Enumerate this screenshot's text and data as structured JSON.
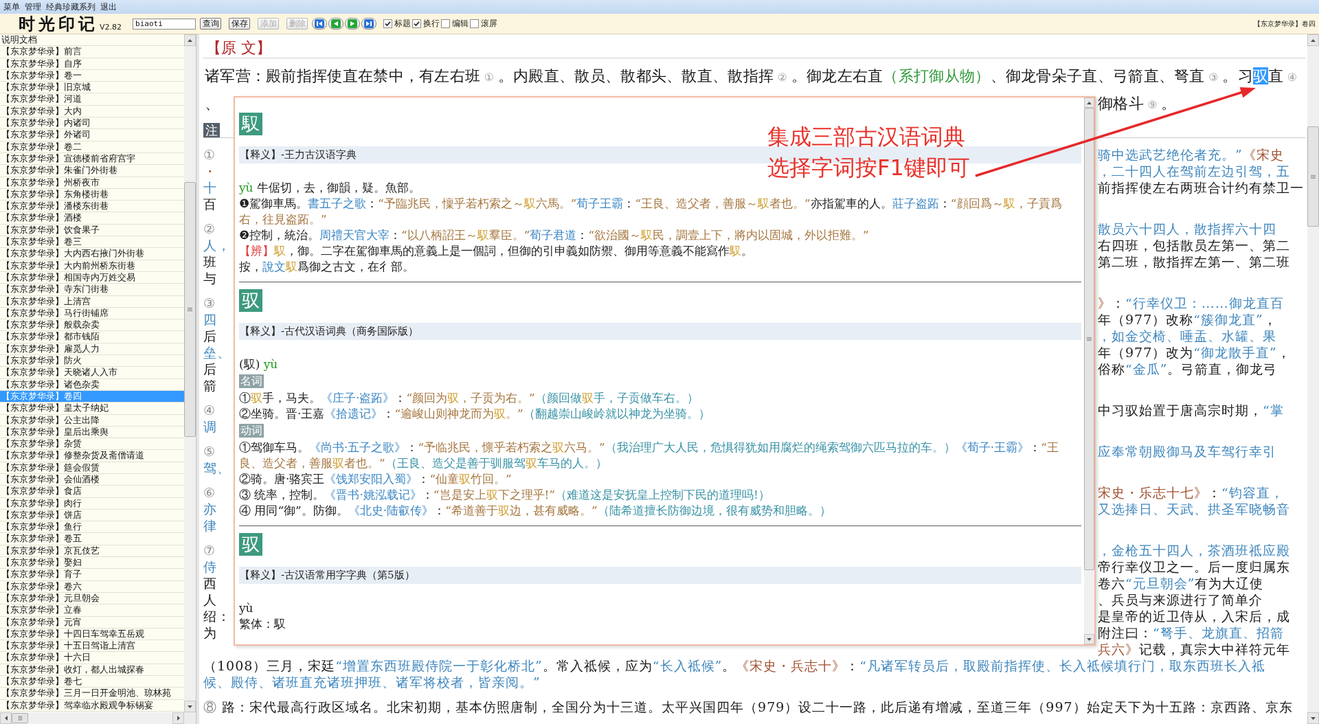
{
  "menu": [
    "菜单",
    "管理",
    "经典珍藏系列",
    "退出"
  ],
  "toolbar": {
    "logo": "时光印记",
    "version": "V2.82",
    "search": {
      "value": "biaoti"
    },
    "buttons": [
      {
        "label": "查询",
        "disabled": false
      },
      {
        "label": "保存",
        "disabled": false
      },
      {
        "label": "添加",
        "disabled": true
      },
      {
        "label": "删除",
        "disabled": true
      }
    ],
    "nav_buttons": [
      {
        "kind": "first"
      },
      {
        "kind": "previous"
      },
      {
        "kind": "next"
      },
      {
        "kind": "last"
      }
    ],
    "checkboxes": [
      {
        "label": "标题",
        "checked": true
      },
      {
        "label": "换行",
        "checked": true
      },
      {
        "label": "编辑",
        "checked": false
      },
      {
        "label": "滚屏",
        "checked": false
      }
    ],
    "location": "【东京梦华录】卷四"
  },
  "sidebar": {
    "items": [
      {
        "label": "说明文档",
        "selected": false
      },
      {
        "label": "【东京梦华录】前言",
        "selected": false
      },
      {
        "label": "【东京梦华录】自序",
        "selected": false
      },
      {
        "label": "【东京梦华录】卷一",
        "selected": false
      },
      {
        "label": "【东京梦华录】旧京城",
        "selected": false
      },
      {
        "label": "【东京梦华录】河道",
        "selected": false
      },
      {
        "label": "【东京梦华录】大内",
        "selected": false
      },
      {
        "label": "【东京梦华录】内诸司",
        "selected": false
      },
      {
        "label": "【东京梦华录】外诸司",
        "selected": false
      },
      {
        "label": "【东京梦华录】卷二",
        "selected": false
      },
      {
        "label": "【东京梦华录】宣德楼前省府宫宇",
        "selected": false
      },
      {
        "label": "【东京梦华录】朱雀门外街巷",
        "selected": false
      },
      {
        "label": "【东京梦华录】州桥夜市",
        "selected": false
      },
      {
        "label": "【东京梦华录】东角楼街巷",
        "selected": false
      },
      {
        "label": "【东京梦华录】潘楼东街巷",
        "selected": false
      },
      {
        "label": "【东京梦华录】酒楼",
        "selected": false
      },
      {
        "label": "【东京梦华录】饮食果子",
        "selected": false
      },
      {
        "label": "【东京梦华录】卷三",
        "selected": false
      },
      {
        "label": "【东京梦华录】大内西右掖门外街巷",
        "selected": false
      },
      {
        "label": "【东京梦华录】大内前州桥东街巷",
        "selected": false
      },
      {
        "label": "【东京梦华录】相国寺内万姓交易",
        "selected": false
      },
      {
        "label": "【东京梦华录】寺东门街巷",
        "selected": false
      },
      {
        "label": "【东京梦华录】上清宫",
        "selected": false
      },
      {
        "label": "【东京梦华录】马行街铺席",
        "selected": false
      },
      {
        "label": "【东京梦华录】般载杂卖",
        "selected": false
      },
      {
        "label": "【东京梦华录】都市钱陌",
        "selected": false
      },
      {
        "label": "【东京梦华录】雇觅人力",
        "selected": false
      },
      {
        "label": "【东京梦华录】防火",
        "selected": false
      },
      {
        "label": "【东京梦华录】天晓诸人入市",
        "selected": false
      },
      {
        "label": "【东京梦华录】诸色杂卖",
        "selected": false
      },
      {
        "label": "【东京梦华录】卷四",
        "selected": true
      },
      {
        "label": "【东京梦华录】皇太子纳妃",
        "selected": false
      },
      {
        "label": "【东京梦华录】公主出降",
        "selected": false
      },
      {
        "label": "【东京梦华录】皇后出乘舆",
        "selected": false
      },
      {
        "label": "【东京梦华录】杂赁",
        "selected": false
      },
      {
        "label": "【东京梦华录】修整杂货及斋僧请道",
        "selected": false
      },
      {
        "label": "【东京梦华录】筵会假赁",
        "selected": false
      },
      {
        "label": "【东京梦华录】会仙酒楼",
        "selected": false
      },
      {
        "label": "【东京梦华录】食店",
        "selected": false
      },
      {
        "label": "【东京梦华录】肉行",
        "selected": false
      },
      {
        "label": "【东京梦华录】饼店",
        "selected": false
      },
      {
        "label": "【东京梦华录】鱼行",
        "selected": false
      },
      {
        "label": "【东京梦华录】卷五",
        "selected": false
      },
      {
        "label": "【东京梦华录】京瓦伎艺",
        "selected": false
      },
      {
        "label": "【东京梦华录】娶妇",
        "selected": false
      },
      {
        "label": "【东京梦华录】育子",
        "selected": false
      },
      {
        "label": "【东京梦华录】卷六",
        "selected": false
      },
      {
        "label": "【东京梦华录】元旦朝会",
        "selected": false
      },
      {
        "label": "【东京梦华录】立春",
        "selected": false
      },
      {
        "label": "【东京梦华录】元宵",
        "selected": false
      },
      {
        "label": "【东京梦华录】十四日车驾幸五岳观",
        "selected": false
      },
      {
        "label": "【东京梦华录】十五日驾诣上清宫",
        "selected": false
      },
      {
        "label": "【东京梦华录】十六日",
        "selected": false
      },
      {
        "label": "【东京梦华录】收灯，都人出城探春",
        "selected": false
      },
      {
        "label": "【东京梦华录】卷七",
        "selected": false
      },
      {
        "label": "【东京梦华录】三月一日开金明池、琼林苑",
        "selected": false
      },
      {
        "label": "【东京梦华录】驾幸临水殿观争标锡宴",
        "selected": false
      }
    ]
  },
  "document": {
    "heading": "【原 文】",
    "lines": [
      {
        "kind": "full",
        "runs": [
          {
            "kind": "plain",
            "text": "诸军营：殿前指挥使直在禁中，有左右班"
          },
          {
            "kind": "num",
            "text": " ① "
          },
          {
            "kind": "plain",
            "text": "。内殿直、散员、散都头、散直、散指挥"
          },
          {
            "kind": "num",
            "text": " ② "
          },
          {
            "kind": "plain",
            "text": "。御龙左右直"
          },
          {
            "kind": "aside",
            "text": "（系打御从物）"
          },
          {
            "kind": "plain",
            "text": "、御龙骨朵子直、弓箭直、弩直"
          },
          {
            "kind": "num",
            "text": " ③ "
          },
          {
            "kind": "plain",
            "text": "。习"
          },
          {
            "kind": "selected",
            "text": "驭"
          },
          {
            "kind": "plain",
            "text": "直"
          },
          {
            "kind": "num",
            "text": " ④"
          }
        ]
      },
      {
        "kind": "split",
        "left": [
          {
            "kind": "plain",
            "text": "、"
          }
        ],
        "right": [
          {
            "kind": "plain",
            "text": "御格斗"
          },
          {
            "kind": "num",
            "text": " ⑨ "
          },
          {
            "kind": "plain",
            "text": "。"
          }
        ]
      }
    ],
    "notes_label": "注",
    "notes": [
      {
        "lines": [
          {
            "kind": "split",
            "left": [
              {
                "kind": "num",
                "text": "①"
              }
            ],
            "right": [
              {
                "kind": "quoted",
                "text": "骑中选武艺绝伦者充。”"
              },
              {
                "kind": "title",
                "text": "《宋史"
              }
            ]
          },
          {
            "kind": "split",
            "left": [
              {
                "kind": "title",
                "text": "・"
              }
            ],
            "right": [
              {
                "kind": "quoted",
                "text": "，二十四人在驾前左边引驾，五"
              }
            ]
          },
          {
            "kind": "split",
            "left": [
              {
                "kind": "quoted",
                "text": "十"
              }
            ],
            "right": [
              {
                "kind": "plain",
                "text": "前指挥使左右两班合计约有禁卫一"
              }
            ]
          },
          {
            "kind": "split",
            "left": [
              {
                "kind": "plain",
                "text": "百"
              }
            ]
          }
        ]
      },
      {
        "lines": [
          {
            "kind": "split",
            "left": [
              {
                "kind": "num",
                "text": "②"
              }
            ],
            "right": [
              {
                "kind": "quoted",
                "text": "散员六十四人，散指挥六十四"
              }
            ]
          },
          {
            "kind": "split",
            "left": [
              {
                "kind": "quoted",
                "text": "人，"
              }
            ],
            "right": [
              {
                "kind": "plain",
                "text": "右四班，包括散员左第一、第二"
              }
            ]
          },
          {
            "kind": "split",
            "left": [
              {
                "kind": "plain",
                "text": "班"
              }
            ],
            "right": [
              {
                "kind": "plain",
                "text": "第二班，散指挥左第一、第二班"
              }
            ]
          },
          {
            "kind": "split",
            "left": [
              {
                "kind": "plain",
                "text": "与"
              }
            ]
          }
        ]
      },
      {
        "lines": [
          {
            "kind": "split",
            "left": [
              {
                "kind": "num",
                "text": "③"
              }
            ],
            "right": [
              {
                "kind": "title",
                "text": "》"
              },
              {
                "kind": "plain",
                "text": "："
              },
              {
                "kind": "quoted",
                "text": "“行幸仪卫：……御龙直百"
              }
            ]
          },
          {
            "kind": "split",
            "left": [
              {
                "kind": "quoted",
                "text": "四"
              }
            ],
            "right": [
              {
                "kind": "plain",
                "text": "年（977）改称"
              },
              {
                "kind": "quoted",
                "text": "“簇御龙直”"
              },
              {
                "kind": "plain",
                "text": "，"
              }
            ]
          },
          {
            "kind": "split",
            "left": [
              {
                "kind": "plain",
                "text": "后"
              }
            ],
            "right": [
              {
                "kind": "quoted",
                "text": "，如金交椅、唾盂、水罐、果"
              }
            ]
          },
          {
            "kind": "split",
            "left": [
              {
                "kind": "quoted",
                "text": "垒、"
              }
            ],
            "right": [
              {
                "kind": "plain",
                "text": "年（977）改为"
              },
              {
                "kind": "quoted",
                "text": "“御龙散手直”"
              },
              {
                "kind": "plain",
                "text": "，"
              }
            ]
          },
          {
            "kind": "split",
            "left": [
              {
                "kind": "plain",
                "text": "后"
              }
            ],
            "right": [
              {
                "kind": "plain",
                "text": "俗称"
              },
              {
                "kind": "quoted",
                "text": "“金瓜”"
              },
              {
                "kind": "plain",
                "text": "。弓箭直，御龙弓"
              }
            ]
          },
          {
            "kind": "split",
            "left": [
              {
                "kind": "plain",
                "text": "箭"
              }
            ]
          }
        ]
      },
      {
        "lines": [
          {
            "kind": "split",
            "left": [
              {
                "kind": "num",
                "text": "④"
              }
            ],
            "right": [
              {
                "kind": "plain",
                "text": "中习驭始置于唐高宗时期，"
              },
              {
                "kind": "quoted",
                "text": "“掌"
              }
            ]
          },
          {
            "kind": "split",
            "left": [
              {
                "kind": "quoted",
                "text": "调"
              }
            ]
          }
        ]
      },
      {
        "lines": [
          {
            "kind": "split",
            "left": [
              {
                "kind": "num",
                "text": "⑤"
              }
            ],
            "right": [
              {
                "kind": "quoted",
                "text": "应奉常朝殿御马及车驾行幸引"
              }
            ]
          },
          {
            "kind": "split",
            "left": [
              {
                "kind": "quoted",
                "text": "驾、"
              }
            ]
          }
        ]
      },
      {
        "lines": [
          {
            "kind": "split",
            "left": [
              {
                "kind": "num",
                "text": "⑥"
              }
            ],
            "right": [
              {
                "kind": "title",
                "text": "宋史・乐志十七》"
              },
              {
                "kind": "plain",
                "text": "："
              },
              {
                "kind": "quoted",
                "text": "“钧容直，"
              }
            ]
          },
          {
            "kind": "split",
            "left": [
              {
                "kind": "quoted",
                "text": "亦"
              }
            ],
            "right": [
              {
                "kind": "quoted",
                "text": "又选捧日、天武、拱圣军晓畅音"
              }
            ]
          },
          {
            "kind": "split",
            "left": [
              {
                "kind": "quoted",
                "text": "律"
              }
            ]
          }
        ]
      },
      {
        "lines": [
          {
            "kind": "split",
            "left": [
              {
                "kind": "num",
                "text": "⑦"
              }
            ],
            "right": [
              {
                "kind": "quoted",
                "text": "，金枪五十四人，茶酒班祗应殿"
              }
            ]
          },
          {
            "kind": "split",
            "left": [
              {
                "kind": "quoted",
                "text": "侍"
              }
            ],
            "right": [
              {
                "kind": "plain",
                "text": "帝行幸仪卫之一。后一度归属东"
              }
            ]
          },
          {
            "kind": "split",
            "left": [
              {
                "kind": "plain",
                "text": "西"
              }
            ],
            "right": [
              {
                "kind": "plain",
                "text": "卷六"
              },
              {
                "kind": "quoted",
                "text": "“元旦朝会”"
              },
              {
                "kind": "plain",
                "text": "有为大辽使"
              }
            ]
          },
          {
            "kind": "split",
            "left": [
              {
                "kind": "plain",
                "text": "人"
              }
            ],
            "right": [
              {
                "kind": "plain",
                "text": "、兵员与来源进行了简单介"
              }
            ]
          },
          {
            "kind": "split",
            "left": [
              {
                "kind": "plain",
                "text": "绍："
              }
            ],
            "right": [
              {
                "kind": "plain",
                "text": "是皇帝的近卫侍从，入宋后，成"
              }
            ]
          },
          {
            "kind": "split",
            "left": [
              {
                "kind": "plain",
                "text": "为"
              }
            ],
            "right": [
              {
                "kind": "plain",
                "text": "附注曰："
              },
              {
                "kind": "quoted",
                "text": "“弩手、龙旗直、招箭"
              }
            ]
          },
          {
            "kind": "split",
            "right": [
              {
                "kind": "title",
                "text": "兵六》"
              },
              {
                "kind": "plain",
                "text": "记载，真宗大中祥符元年"
              }
            ]
          },
          {
            "kind": "full",
            "runs": [
              {
                "kind": "plain",
                "text": "（1008）三月，宋廷"
              },
              {
                "kind": "quoted",
                "text": "“增置东西班殿侍院一于彰化桥北”"
              },
              {
                "kind": "plain",
                "text": "。常入祗候，应为"
              },
              {
                "kind": "quoted",
                "text": "“长入祗候”"
              },
              {
                "kind": "plain",
                "text": "。"
              },
              {
                "kind": "title",
                "text": "《宋史・兵志十》"
              },
              {
                "kind": "plain",
                "text": "："
              },
              {
                "kind": "quoted",
                "text": "“凡诸军转员后，取殿前指挥使、长入祗候填行门，取东西班长入祗"
              }
            ]
          },
          {
            "kind": "full",
            "runs": [
              {
                "kind": "quoted",
                "text": "候、殿侍、诸班直充诸班押班、诸军将校者，皆亲阅。”"
              }
            ]
          }
        ]
      },
      {
        "lines": [
          {
            "kind": "full",
            "runs": [
              {
                "kind": "num",
                "text": "⑧"
              },
              {
                "kind": "plain",
                "text": " 路：宋代最高行政区域名。北宋初期，基本仿照唐制，全国分为十三道。太平兴国四年（979）设二十一路，此后递有增减，至道三年（997）始定天下为十五路：京西路、京东"
              }
            ]
          }
        ]
      }
    ]
  },
  "popup": {
    "entries": [
      {
        "headword": "馭",
        "source": "【释义】-王力古汉语字典",
        "lines": [
          {
            "kind": "text",
            "runs": [
              {
                "kind": "pinyin",
                "text": "yù"
              },
              {
                "kind": "plain",
                "text": " 牛倨切，去，御韻，疑。魚部。"
              }
            ]
          },
          {
            "kind": "text",
            "runs": [
              {
                "kind": "plain",
                "text": "❶駕御車馬。"
              },
              {
                "kind": "book",
                "text": "書五子之歌"
              },
              {
                "kind": "plain",
                "text": "："
              },
              {
                "kind": "citation",
                "text": "“予臨兆民，懍乎若朽索之～"
              },
              {
                "kind": "head",
                "text": "馭"
              },
              {
                "kind": "citation",
                "text": "六馬。”"
              },
              {
                "kind": "book",
                "text": "荀子王霸"
              },
              {
                "kind": "plain",
                "text": "："
              },
              {
                "kind": "citation",
                "text": "“王良、造父者，善服～"
              },
              {
                "kind": "head",
                "text": "馭"
              },
              {
                "kind": "citation",
                "text": "者也。”"
              },
              {
                "kind": "plain",
                "text": "亦指駕車的人。"
              },
              {
                "kind": "book",
                "text": "莊子盗跖"
              },
              {
                "kind": "plain",
                "text": "："
              },
              {
                "kind": "citation",
                "text": "“顔回爲～"
              },
              {
                "kind": "head",
                "text": "馭"
              },
              {
                "kind": "citation",
                "text": "，子貢爲右，往見盗跖。”"
              }
            ]
          },
          {
            "kind": "text",
            "runs": [
              {
                "kind": "plain",
                "text": "❷控制，統治。"
              },
              {
                "kind": "book",
                "text": "周禮天官大宰"
              },
              {
                "kind": "plain",
                "text": "："
              },
              {
                "kind": "citation",
                "text": "“以八柄詔王～"
              },
              {
                "kind": "head",
                "text": "馭"
              },
              {
                "kind": "citation",
                "text": "羣臣。”"
              },
              {
                "kind": "book",
                "text": "荀子君道"
              },
              {
                "kind": "plain",
                "text": "："
              },
              {
                "kind": "citation",
                "text": "“欲治國～"
              },
              {
                "kind": "head",
                "text": "馭"
              },
              {
                "kind": "citation",
                "text": "民，調壹上下，將内以固城，外以拒難。”"
              }
            ]
          },
          {
            "kind": "text",
            "runs": [
              {
                "kind": "note",
                "text": "【辨】"
              },
              {
                "kind": "head",
                "text": "馭"
              },
              {
                "kind": "plain",
                "text": "，御。二字在駕御車馬的意義上是一個詞，但御的引申義如防禦、御用等意義不能寫作"
              },
              {
                "kind": "head",
                "text": "馭"
              },
              {
                "kind": "plain",
                "text": "。"
              }
            ]
          },
          {
            "kind": "text",
            "runs": [
              {
                "kind": "plain",
                "text": "按，"
              },
              {
                "kind": "book",
                "text": "說文"
              },
              {
                "kind": "head",
                "text": "馭"
              },
              {
                "kind": "plain",
                "text": "爲御之古文，在彳部。"
              }
            ]
          }
        ]
      },
      {
        "headword": "驭",
        "source": "【释义】-古代汉语词典（商务国际版）",
        "lines": [
          {
            "kind": "text",
            "runs": [
              {
                "kind": "plain",
                "text": "(馭) "
              },
              {
                "kind": "pinyin",
                "text": "yù"
              }
            ]
          },
          {
            "kind": "label",
            "text": "名词"
          },
          {
            "kind": "text",
            "runs": [
              {
                "kind": "plain",
                "text": "①"
              },
              {
                "kind": "head",
                "text": "驭"
              },
              {
                "kind": "plain",
                "text": "手，马夫。"
              },
              {
                "kind": "book",
                "text": "《庄子·盗跖》"
              },
              {
                "kind": "plain",
                "text": "："
              },
              {
                "kind": "citation",
                "text": "“颜回为"
              },
              {
                "kind": "head",
                "text": "驭"
              },
              {
                "kind": "citation",
                "text": "，子贡为右。”"
              },
              {
                "kind": "gloss",
                "text": "（颜回做"
              },
              {
                "kind": "head",
                "text": "驭"
              },
              {
                "kind": "gloss",
                "text": "手，子贡做车右。）"
              }
            ]
          },
          {
            "kind": "text",
            "runs": [
              {
                "kind": "plain",
                "text": "②坐骑。晋·王嘉"
              },
              {
                "kind": "book",
                "text": "《拾遗记》"
              },
              {
                "kind": "plain",
                "text": "："
              },
              {
                "kind": "citation",
                "text": "“逾峻山则神龙而为"
              },
              {
                "kind": "head",
                "text": "驭"
              },
              {
                "kind": "citation",
                "text": "。”"
              },
              {
                "kind": "gloss",
                "text": "（翻越崇山峻岭就以神龙为坐骑。）"
              }
            ]
          },
          {
            "kind": "label",
            "text": "动词"
          },
          {
            "kind": "text",
            "runs": [
              {
                "kind": "plain",
                "text": "①驾御车马。"
              },
              {
                "kind": "book",
                "text": "《尚书·五子之歌》"
              },
              {
                "kind": "plain",
                "text": "："
              },
              {
                "kind": "citation",
                "text": "“予临兆民，懔乎若朽索之"
              },
              {
                "kind": "head",
                "text": "驭"
              },
              {
                "kind": "citation",
                "text": "六马。”"
              },
              {
                "kind": "gloss",
                "text": "（我治理广大人民，危惧得犹如用腐烂的绳索驾御六匹马拉的车。）"
              },
              {
                "kind": "book",
                "text": "《荀子·王霸》"
              },
              {
                "kind": "plain",
                "text": "："
              },
              {
                "kind": "citation",
                "text": "“王良、造父者，善服"
              },
              {
                "kind": "head",
                "text": "驭"
              },
              {
                "kind": "citation",
                "text": "者也。”"
              },
              {
                "kind": "gloss",
                "text": "（王良、造父是善于驯服驾"
              },
              {
                "kind": "head",
                "text": "驭"
              },
              {
                "kind": "gloss",
                "text": "车马的人。）"
              }
            ]
          },
          {
            "kind": "text",
            "runs": [
              {
                "kind": "plain",
                "text": "②骑。唐·骆宾王"
              },
              {
                "kind": "book",
                "text": "《饯郑安阳入蜀》"
              },
              {
                "kind": "plain",
                "text": "："
              },
              {
                "kind": "citation",
                "text": "“仙童"
              },
              {
                "kind": "head",
                "text": "驭"
              },
              {
                "kind": "citation",
                "text": "竹回。”"
              }
            ]
          },
          {
            "kind": "text",
            "runs": [
              {
                "kind": "plain",
                "text": "③ 统率，控制。"
              },
              {
                "kind": "book",
                "text": "《晋书·姚泓载记》"
              },
              {
                "kind": "plain",
                "text": "："
              },
              {
                "kind": "citation",
                "text": "“岂是安上"
              },
              {
                "kind": "head",
                "text": "驭"
              },
              {
                "kind": "citation",
                "text": "下之理乎!”"
              },
              {
                "kind": "gloss",
                "text": "（难道这是安抚皇上控制下民的道理吗!）"
              }
            ]
          },
          {
            "kind": "text",
            "runs": [
              {
                "kind": "plain",
                "text": "④ 用同“御”。防御。"
              },
              {
                "kind": "book",
                "text": "《北史·陆叡传》"
              },
              {
                "kind": "plain",
                "text": "："
              },
              {
                "kind": "citation",
                "text": "“希道善于"
              },
              {
                "kind": "head",
                "text": "驭"
              },
              {
                "kind": "citation",
                "text": "边，甚有威略。”"
              },
              {
                "kind": "gloss",
                "text": "（陆希道擅长防御边境，很有威势和胆略。）"
              }
            ]
          }
        ]
      },
      {
        "headword": "驭",
        "source": "【释义】-古汉语常用字字典（第5版）",
        "lines": [
          {
            "kind": "text",
            "runs": [
              {
                "kind": "plain",
                "text": "yù"
              }
            ]
          },
          {
            "kind": "text",
            "runs": [
              {
                "kind": "plain",
                "text": "繁体：馭"
              }
            ]
          }
        ]
      }
    ]
  },
  "annotation": {
    "lines": [
      "集成三部古汉语词典",
      "选择字词按F1键即可"
    ]
  }
}
